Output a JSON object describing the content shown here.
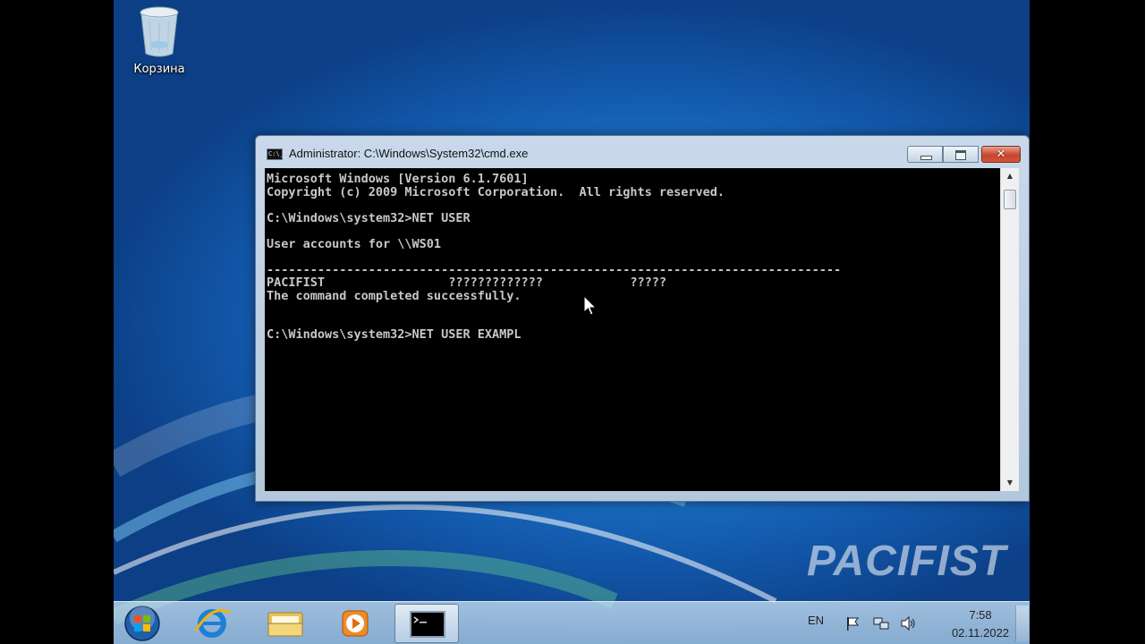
{
  "desktop": {
    "recycle_bin_label": "Корзина",
    "watermark": "PACIFIST"
  },
  "cmd_window": {
    "title": "Administrator: C:\\Windows\\System32\\cmd.exe",
    "icon_glyph": "C:\\_",
    "console_lines": [
      "Microsoft Windows [Version 6.1.7601]",
      "Copyright (c) 2009 Microsoft Corporation.  All rights reserved.",
      "",
      "C:\\Windows\\system32>NET USER",
      "",
      "User accounts for \\\\WS01",
      "",
      "-------------------------------------------------------------------------------",
      "PACIFIST                 ?????????????            ?????",
      "The command completed successfully.",
      "",
      "",
      "C:\\Windows\\system32>NET USER EXAMPL"
    ],
    "close_glyph": "✕",
    "scroll_up_glyph": "▲",
    "scroll_down_glyph": "▼"
  },
  "taskbar": {
    "language": "EN",
    "time": "7:58",
    "date": "02.11.2022",
    "items": [
      "start-orb-icon",
      "internet-explorer-icon",
      "windows-explorer-icon",
      "media-player-icon",
      "command-prompt-icon"
    ]
  },
  "colors": {
    "console_bg": "#000000",
    "console_text": "#c8c8c8",
    "desktop_blue": "#1c74c9",
    "close_red": "#c7452c"
  }
}
